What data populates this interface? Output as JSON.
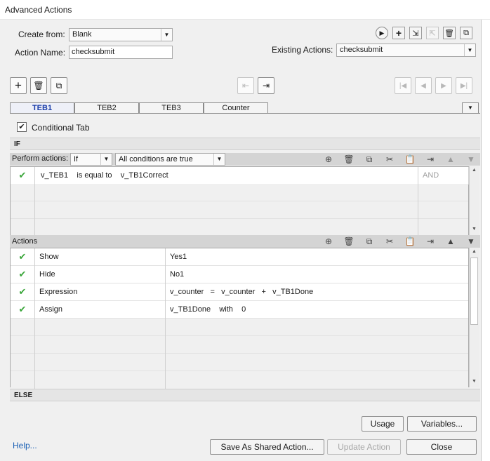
{
  "window": {
    "title": "Advanced Actions"
  },
  "form": {
    "create_from_label": "Create from:",
    "create_from_value": "Blank",
    "action_name_label": "Action Name:",
    "action_name_value": "checksubmit",
    "existing_actions_label": "Existing Actions:",
    "existing_actions_value": "checksubmit"
  },
  "tabs": [
    {
      "label": "TEB1",
      "active": true
    },
    {
      "label": "TEB2",
      "active": false
    },
    {
      "label": "TEB3",
      "active": false
    },
    {
      "label": "Counter",
      "active": false
    }
  ],
  "conditional": {
    "label": "Conditional Tab",
    "checked": true
  },
  "if_section": {
    "header": "IF",
    "perform_label": "Perform actions:",
    "perform_value": "If",
    "conditions_value": "All conditions are true",
    "rows": [
      {
        "checked": true,
        "var": "v_TEB1",
        "op": "is equal to",
        "value": "v_TB1Correct",
        "logic": "AND"
      }
    ]
  },
  "actions_section": {
    "header": "Actions",
    "rows": [
      {
        "checked": true,
        "command": "Show",
        "detail": "Yes1"
      },
      {
        "checked": true,
        "command": "Hide",
        "detail": "No1"
      },
      {
        "checked": true,
        "command": "Expression",
        "detail": "v_counter   =   v_counter   +   v_TB1Done"
      },
      {
        "checked": true,
        "command": "Assign",
        "detail": "v_TB1Done    with    0"
      }
    ]
  },
  "else_section": {
    "header": "ELSE"
  },
  "buttons": {
    "usage": "Usage",
    "variables": "Variables...",
    "help": "Help...",
    "save_shared": "Save As Shared Action...",
    "update_action": "Update Action",
    "close": "Close"
  },
  "icons": {
    "check_color": "#3aa63a",
    "active_tab_color": "#1c3faa",
    "link_color": "#1a5fb4"
  }
}
